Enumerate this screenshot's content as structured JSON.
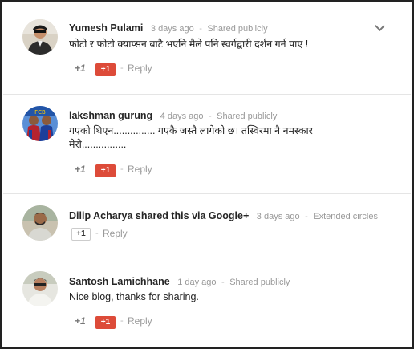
{
  "comments": [
    {
      "author": "Yumesh Pulami",
      "time": "3 days ago",
      "visibility": "Shared publicly",
      "text": "फोटो र फोटो क्याप्सन बाटै भएनि मैले पनि   स्वर्गद्वारी दर्शन गर्न पाए !",
      "plus_text": "+1",
      "plus_button": "+1",
      "reply": "Reply",
      "avatar_icon": "profile-photo"
    },
    {
      "author": "lakshman gurung",
      "time": "4 days ago",
      "visibility": "Shared publicly",
      "text": "गएको थिएन............... गएकै जस्तै लागेको छ। तस्विरमा नै नमस्कार मेरो................",
      "plus_text": "+1",
      "plus_button": "+1",
      "reply": "Reply",
      "avatar_icon": "profile-photo"
    },
    {
      "author": "Dilip Acharya",
      "share_text": "shared this via Google+",
      "time": "3 days ago",
      "visibility": "Extended circles",
      "plus_button": "+1",
      "reply": "Reply",
      "avatar_icon": "profile-photo"
    },
    {
      "author": "Santosh Lamichhane",
      "time": "1 day ago",
      "visibility": "Shared publicly",
      "text": "Nice blog, thanks for sharing.",
      "plus_text": "+1",
      "plus_button": "+1",
      "reply": "Reply",
      "avatar_icon": "profile-photo"
    }
  ],
  "separator": "-",
  "menu_icon": "chevron-down-icon",
  "colors": {
    "plus_button": "#dd4b39",
    "meta": "#999999",
    "border": "#e5e5e5"
  }
}
